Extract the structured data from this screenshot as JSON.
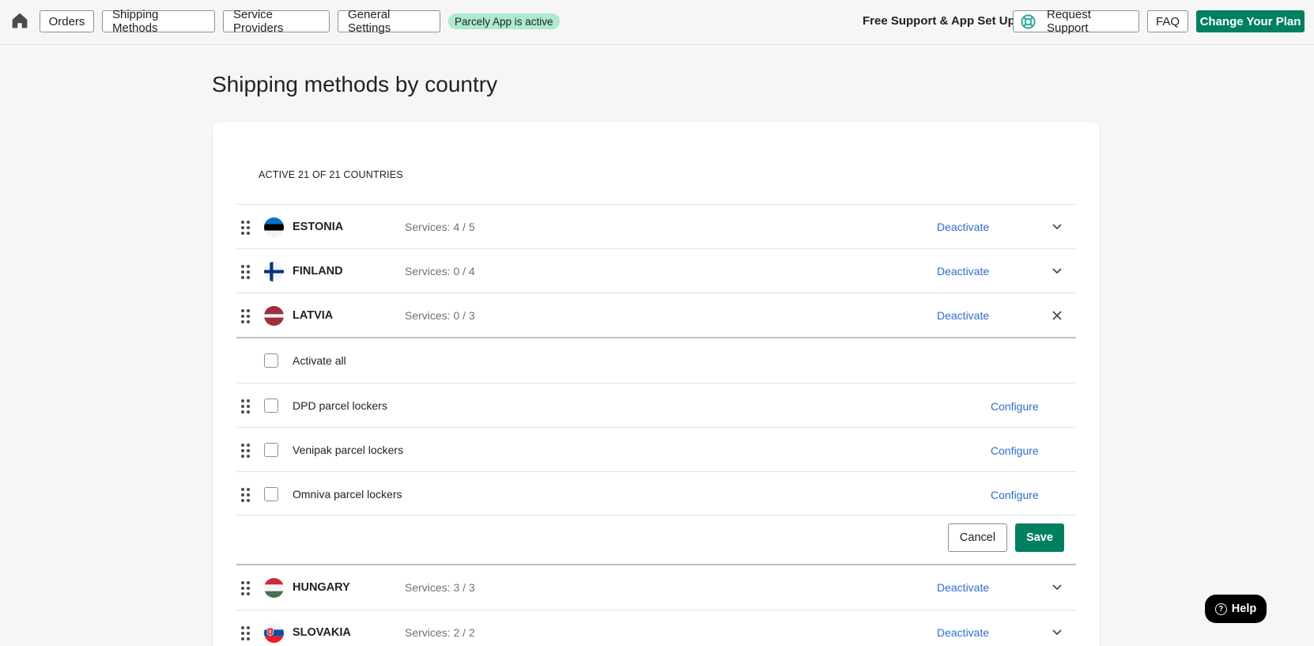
{
  "nav": {
    "orders": "Orders",
    "shipping_methods": "Shipping Methods",
    "service_providers": "Service Providers",
    "general_settings": "General Settings",
    "status": "Parcely App is active",
    "support_text": "Free Support & App Set Up",
    "request_support": "Request Support",
    "faq": "FAQ",
    "change_plan": "Change Your Plan"
  },
  "page": {
    "title": "Shipping methods by country",
    "active_count": "ACTIVE 21 OF 21 COUNTRIES"
  },
  "countries": [
    {
      "name": "ESTONIA",
      "services": "Services: 4 / 5",
      "action": "Deactivate"
    },
    {
      "name": "FINLAND",
      "services": "Services: 0 / 4",
      "action": "Deactivate"
    },
    {
      "name": "LATVIA",
      "services": "Services: 0 / 3",
      "action": "Deactivate"
    },
    {
      "name": "HUNGARY",
      "services": "Services: 3 / 3",
      "action": "Deactivate"
    },
    {
      "name": "SLOVAKIA",
      "services": "Services: 2 / 2",
      "action": "Deactivate"
    }
  ],
  "expanded": {
    "activate_all": "Activate all",
    "services": [
      {
        "label": "DPD parcel lockers",
        "action": "Configure"
      },
      {
        "label": "Venipak parcel lockers",
        "action": "Configure"
      },
      {
        "label": "Omniva parcel lockers",
        "action": "Configure"
      }
    ],
    "cancel": "Cancel",
    "save": "Save"
  },
  "help": "Help",
  "colors": {
    "primary": "#008060",
    "link": "#2c6ecb",
    "status_bg": "#aee9d1"
  }
}
